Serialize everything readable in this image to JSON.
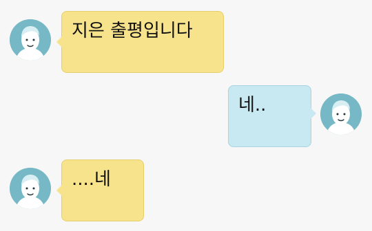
{
  "chat": {
    "messages": [
      {
        "sender": "other",
        "text": "지은 출평입니다",
        "bubble_color": "#f7e38c",
        "avatar_icon": "user-avatar-icon"
      },
      {
        "sender": "self",
        "text": "네..",
        "bubble_color": "#c8e8f2",
        "avatar_icon": "user-avatar-icon"
      },
      {
        "sender": "other",
        "text": "....네",
        "bubble_color": "#f7e38c",
        "avatar_icon": "user-avatar-icon"
      }
    ],
    "avatar_color": "#76b8c6",
    "background_color": "#f7f7f7"
  }
}
